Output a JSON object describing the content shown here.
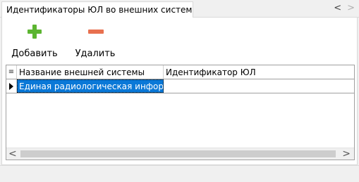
{
  "tab": {
    "title": "Идентификаторы ЮЛ во внешних системах"
  },
  "tab_nav": {
    "prev_icon": "chevron-left-icon",
    "next_icon": "chevron-right-icon"
  },
  "toolbar": {
    "add_label": "Добавить",
    "add_icon": "plus-icon",
    "add_color": "#5cb531",
    "delete_label": "Удалить",
    "delete_icon": "minus-icon",
    "delete_color": "#e8704f"
  },
  "grid": {
    "columns": [
      "Название внешней системы",
      "Идентификатор ЮЛ"
    ],
    "rows": [
      {
        "cells": [
          "Единая радиологическая информ",
          ""
        ],
        "selected": true
      }
    ],
    "selection_color": "#0a78d7"
  }
}
